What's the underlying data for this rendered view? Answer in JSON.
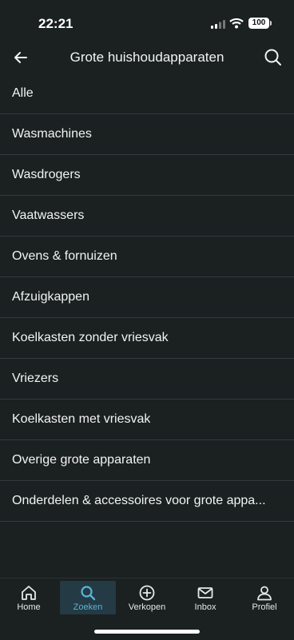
{
  "status": {
    "time": "22:21",
    "battery": "100"
  },
  "header": {
    "title": "Grote huishoudapparaten"
  },
  "categories": [
    "Alle",
    "Wasmachines",
    "Wasdrogers",
    "Vaatwassers",
    "Ovens & fornuizen",
    "Afzuigkappen",
    "Koelkasten zonder vriesvak",
    "Vriezers",
    "Koelkasten met vriesvak",
    "Overige grote apparaten",
    "Onderdelen & accessoires voor grote appa..."
  ],
  "nav": {
    "home": "Home",
    "search": "Zoeken",
    "sell": "Verkopen",
    "inbox": "Inbox",
    "profile": "Profiel"
  },
  "colors": {
    "accent": "#5ab4d6",
    "background": "#1b2021",
    "divider": "#343b3c"
  }
}
